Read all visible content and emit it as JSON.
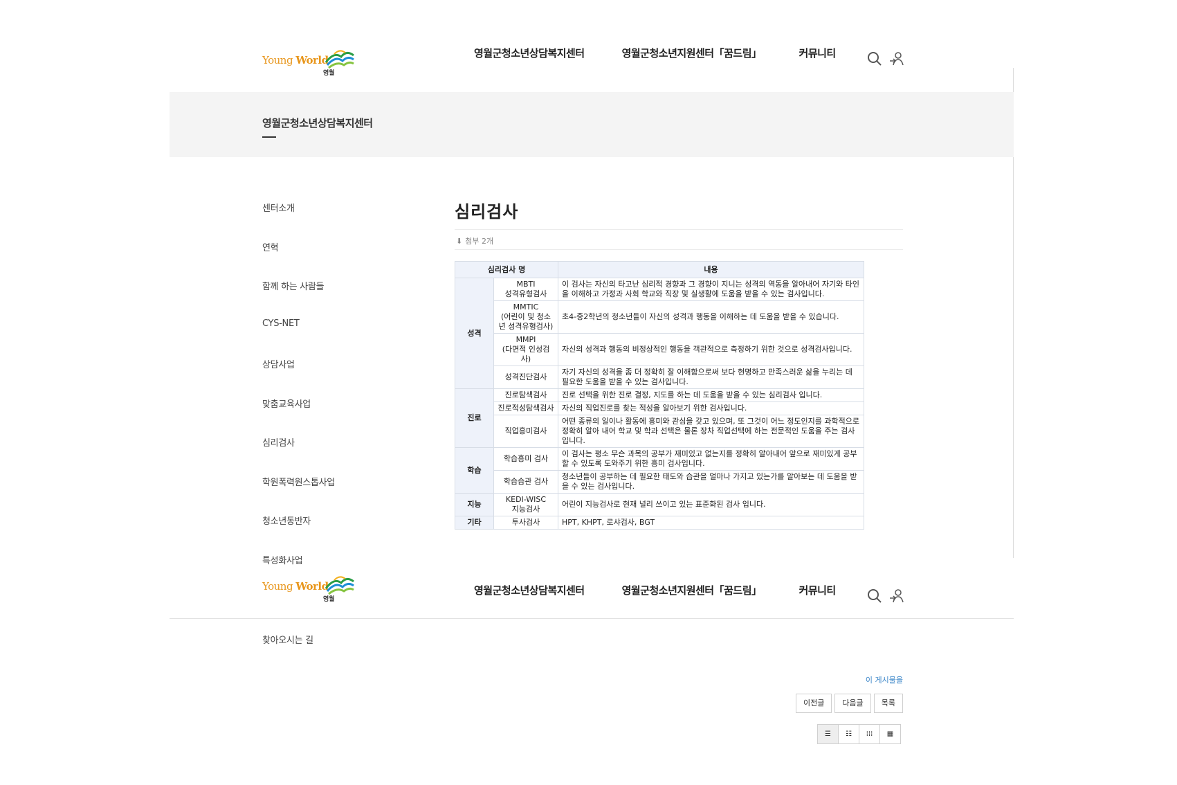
{
  "logo": {
    "word_young": "Young",
    "word_world": "World",
    "sub": "영월"
  },
  "gnb": [
    "영월군청소년상담복지센터",
    "영월군청소년지원센터「꿈드림」",
    "커뮤니티"
  ],
  "band": {
    "title": "영월군청소년상담복지센터"
  },
  "lnb": [
    "센터소개",
    "연혁",
    "함께 하는 사람들",
    "CYS-NET",
    "상담사업",
    "맞춤교육사업",
    "심리검사",
    "학원폭력원스톱사업",
    "청소년동반자",
    "특성화사업",
    "찾아오시는 길"
  ],
  "post": {
    "title": "심리검사",
    "attach": "첨부 2개"
  },
  "table": {
    "head": [
      "심리검사 명",
      "내용"
    ],
    "groups": [
      {
        "cat": "성격",
        "rows": [
          {
            "name": "MBTI\n성격유형검사",
            "desc": "이 검사는 자신의 타고난 심리적 경향과 그 경향이 지니는 성격의 역동을 알아내어 자기와 타인을 이해하고 가정과 사회 학교와 직장 및 실생활에 도움을 받을 수 있는 검사입니다."
          },
          {
            "name": "MMTIC\n(어린이 및 청소년 성격유형검사)",
            "desc": "초4-중2학년의 청소년들이 자신의 성격과 행동을 이해하는 데 도움을 받을 수 있습니다."
          },
          {
            "name": "MMPI\n(다면적 인성검사)",
            "desc": "자신의 성격과 행동의 비정상적인 행동을 객관적으로 측정하기 위한 것으로 성격검사입니다."
          },
          {
            "name": "성격진단검사",
            "desc": "자기 자신의 성격을 좀 더 정확히 잘 이해함으로써 보다 현명하고 만족스러운 삶을 누리는 데 필요한 도움을 받을 수 있는 검사입니다."
          }
        ]
      },
      {
        "cat": "진로",
        "rows": [
          {
            "name": "진로탐색검사",
            "desc": "진로 선택을 위한 진로 결정, 지도를 하는 데 도움을 받을 수 있는 심리검사 입니다."
          },
          {
            "name": "진로적성탐색검사",
            "desc": "자신의 직업진로를 찾는 적성을 알아보기 위한 검사입니다."
          },
          {
            "name": "직업흥미검사",
            "desc": "어떤 종류의 일이나 활동에 흥미와 관심을 갖고 있으며, 또 그것이 어느 정도인지를 과학적으로 정확히 알아 내어 학교 및 학과 선택은 물론 장차 직업선택에 하는 전문적인 도움을 주는 검사입니다."
          }
        ]
      },
      {
        "cat": "학습",
        "rows": [
          {
            "name": "학습흥미 검사",
            "desc": "이 검사는 평소 무슨 과목의 공부가 재미있고 없는지를 정확히 알아내어 앞으로 재미있게 공부할 수 있도록 도와주기 위한 흥미 검사입니다."
          },
          {
            "name": "학습습관 검사",
            "desc": "청소년들이 공부하는 데 필요한 태도와 습관을 얼마나 가지고 있는가를 알아보는 데 도움을 받을 수 있는 검사입니다."
          }
        ]
      },
      {
        "cat": "지능",
        "rows": [
          {
            "name": "KEDI-WISC\n지능검사",
            "desc": "어린이 지능검사로 현재 널리 쓰이고 있는 표준화된 검사 입니다."
          }
        ]
      },
      {
        "cat": "기타",
        "rows": [
          {
            "name": "투사검사",
            "desc": "HPT, KHPT, 로샤검사, BGT"
          }
        ]
      }
    ]
  },
  "after": {
    "relink": "이 게시물을",
    "prev": "이전글",
    "next": "다음글",
    "list": "목록"
  }
}
